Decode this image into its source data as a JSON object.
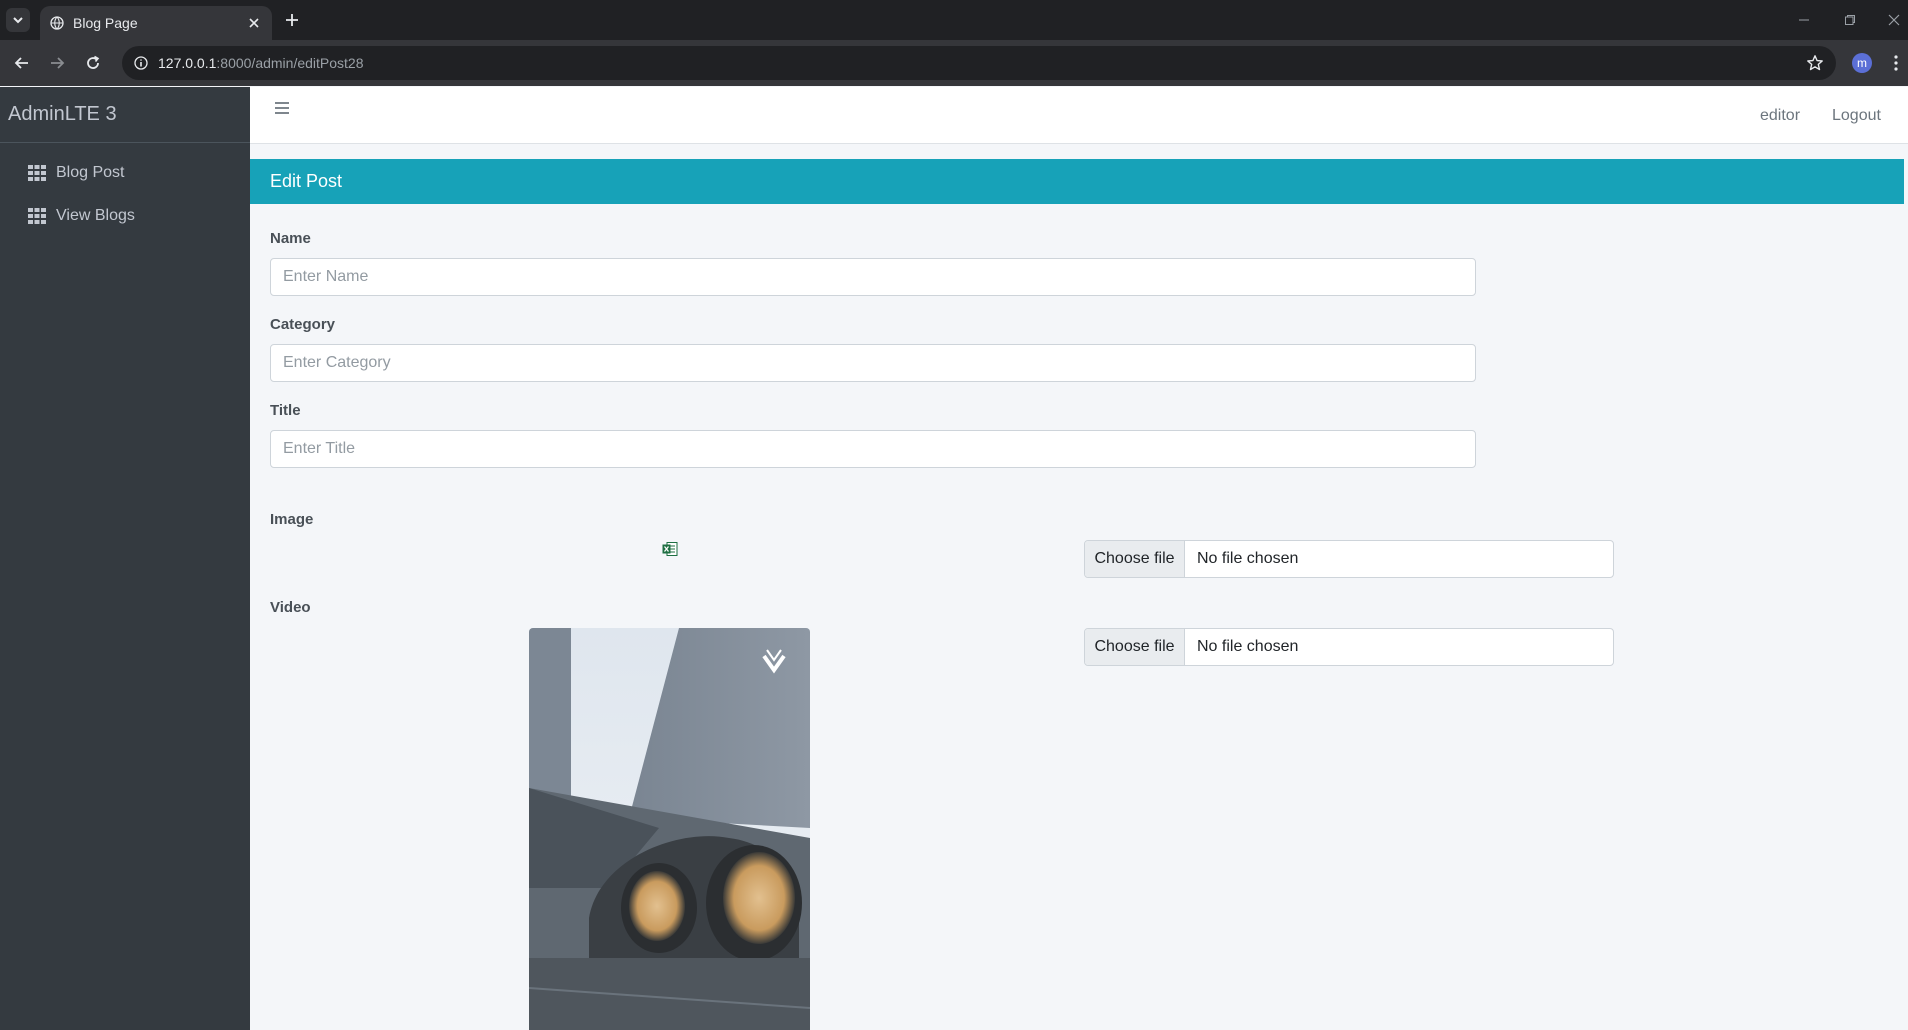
{
  "browser": {
    "tab_title": "Blog Page",
    "url_host": "127.0.0.1",
    "url_rest": ":8000/admin/editPost28",
    "profile_initial": "m"
  },
  "sidebar": {
    "brand": "AdminLTE 3",
    "items": [
      {
        "label": "Blog Post",
        "icon": "grid-icon"
      },
      {
        "label": "View Blogs",
        "icon": "grid-icon"
      }
    ]
  },
  "navbar": {
    "user_label": "editor",
    "logout_label": "Logout"
  },
  "form": {
    "header": "Edit Post",
    "name_label": "Name",
    "name_placeholder": "Enter Name",
    "category_label": "Category",
    "category_placeholder": "Enter Category",
    "title_label": "Title",
    "title_placeholder": "Enter Title",
    "image_label": "Image",
    "video_label": "Video",
    "choose_file_label": "Choose file",
    "no_file_label": "No file chosen"
  },
  "colors": {
    "accent": "#17a2b8",
    "sidebar_bg": "#343a40"
  }
}
